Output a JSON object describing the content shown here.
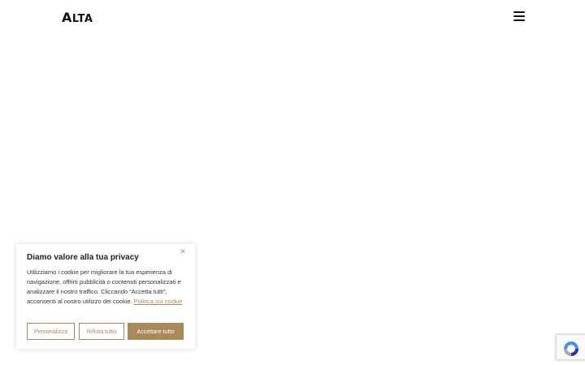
{
  "header": {
    "logo_initial": "A",
    "logo_rest": "LTA",
    "menu_icon": "hamburger-menu-icon"
  },
  "cookie_banner": {
    "title": "Diamo valore alla tua privacy",
    "close_icon": "close-icon",
    "text": "Utilizziamo i cookie per migliorare la tua esperienza di navigazione, offrirti pubblicità o contenuti personalizzati e analizzare il nostro traffico. Cliccando “Accetta tutti”, acconsenti al nostro utilizzo dei cookie.",
    "policy_link": "Politica sui cookie",
    "buttons": {
      "customize": "Personalizza",
      "reject": "Rifiuta tutto",
      "accept": "Accettare tutto"
    },
    "accent_color": "#a9895a"
  },
  "recaptcha": {
    "icon": "recaptcha-icon"
  }
}
